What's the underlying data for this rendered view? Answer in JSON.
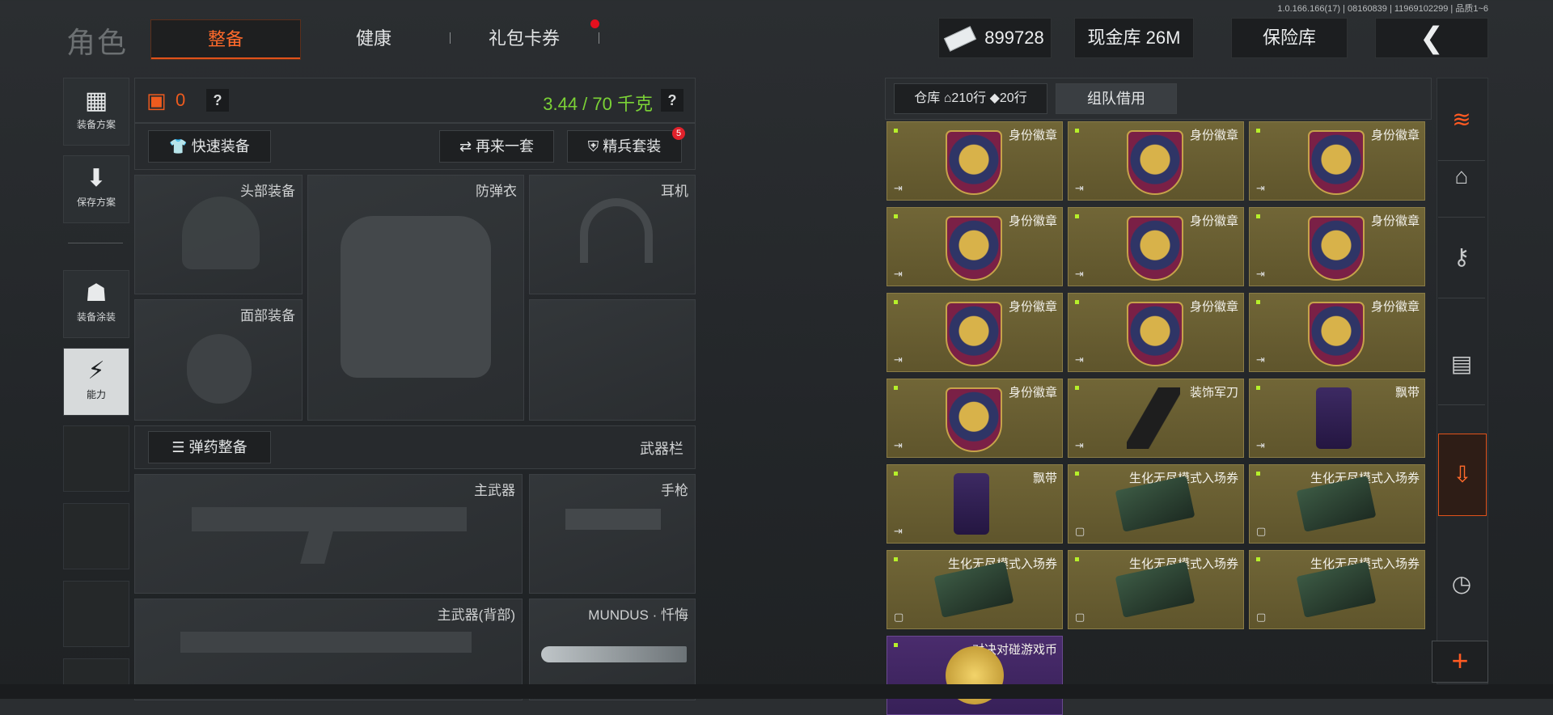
{
  "version_text": "1.0.166.166(17) | 08160839 | 11969102299 | 品质1~6",
  "header": {
    "title": "角色",
    "tabs": [
      "整备",
      "健康",
      "礼包卡券"
    ],
    "currency": "899728",
    "cash_vault": "现金库 26M",
    "insurance": "保险库",
    "back_icon": "back-arrow-icon"
  },
  "left_sidebar": {
    "items": [
      "装备方案",
      "保存方案",
      "装备涂装",
      "能力"
    ]
  },
  "loadout": {
    "armor_count": "0",
    "weight": "3.44 / 70 千克",
    "quick_equip": "快速装备",
    "again": "再来一套",
    "elite": "精兵套装",
    "elite_badge": "5",
    "slots": {
      "head": "头部装备",
      "vest": "防弹衣",
      "ear": "耳机",
      "face": "面部装备"
    },
    "ammo_btn": "弹药整备",
    "weapon_bar": "武器栏",
    "weapons": {
      "primary": "主武器",
      "pistol": "手枪",
      "primary_back": "主武器(背部)",
      "melee": "MUNDUS · 忏悔"
    }
  },
  "warehouse": {
    "label": "仓库",
    "rows": "210行",
    "rows2": "20行",
    "team_borrow": "组队借用",
    "items": [
      {
        "name": "身份徽章",
        "kind": "badge"
      },
      {
        "name": "身份徽章",
        "kind": "badge"
      },
      {
        "name": "身份徽章",
        "kind": "badge"
      },
      {
        "name": "身份徽章",
        "kind": "badge"
      },
      {
        "name": "身份徽章",
        "kind": "badge"
      },
      {
        "name": "身份徽章",
        "kind": "badge"
      },
      {
        "name": "身份徽章",
        "kind": "badge"
      },
      {
        "name": "身份徽章",
        "kind": "badge"
      },
      {
        "name": "身份徽章",
        "kind": "badge"
      },
      {
        "name": "身份徽章",
        "kind": "badge"
      },
      {
        "name": "装饰军刀",
        "kind": "knife"
      },
      {
        "name": "飘带",
        "kind": "scarf"
      },
      {
        "name": "飘带",
        "kind": "scarf"
      },
      {
        "name": "生化无尽模式入场券",
        "kind": "ticket"
      },
      {
        "name": "生化无尽模式入场券",
        "kind": "ticket"
      },
      {
        "name": "生化无尽模式入场券",
        "kind": "ticket"
      },
      {
        "name": "生化无尽模式入场券",
        "kind": "ticket"
      },
      {
        "name": "生化无尽模式入场券",
        "kind": "ticket"
      },
      {
        "name": "对决对碰游戏币",
        "kind": "coin"
      }
    ]
  },
  "right_rail": [
    "stack-refresh-icon",
    "home-icon",
    "key-icon",
    "cash-icon",
    "import-icon",
    "clock-icon",
    "plus-icon"
  ]
}
